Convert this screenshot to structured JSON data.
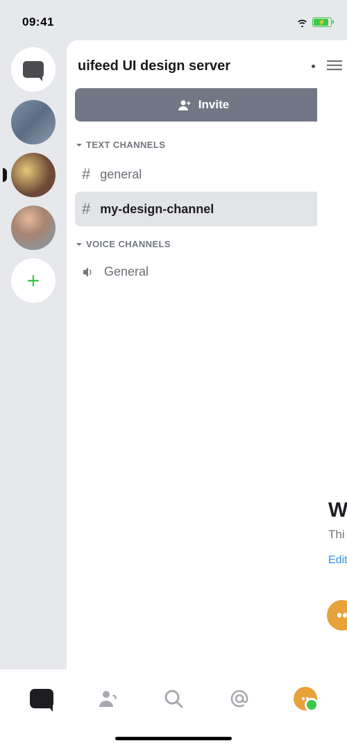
{
  "statusBar": {
    "time": "09:41"
  },
  "server": {
    "title": "uifeed UI design server",
    "inviteLabel": "Invite"
  },
  "categories": {
    "text": {
      "label": "TEXT CHANNELS",
      "channels": [
        {
          "name": "general",
          "selected": false
        },
        {
          "name": "my-design-channel",
          "selected": true
        }
      ]
    },
    "voice": {
      "label": "VOICE CHANNELS",
      "channels": [
        {
          "name": "General"
        }
      ]
    }
  },
  "peek": {
    "heading": "W",
    "subtext": "Thi",
    "editLabel": "Edit"
  },
  "serverRail": {
    "items": [
      "dm",
      "server-1",
      "server-2",
      "server-3",
      "add-server"
    ]
  },
  "bottomNav": {
    "items": [
      "discord",
      "friends",
      "search",
      "mentions",
      "profile"
    ]
  }
}
